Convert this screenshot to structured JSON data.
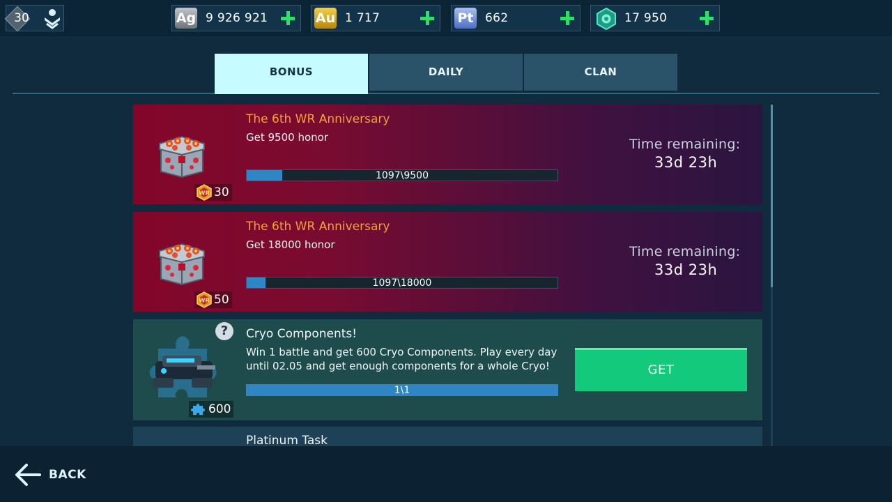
{
  "header": {
    "level": "30",
    "currencies": [
      {
        "symbol": "Ag",
        "value": "9 926 921",
        "color": "#9aa0a5"
      },
      {
        "symbol": "Au",
        "value": "1 717",
        "color": "#d4a017"
      },
      {
        "symbol": "Pt",
        "value": "662",
        "color": "#6b8bd8"
      },
      {
        "symbol": "",
        "icon": "key-hexagon-icon",
        "value": "17 950",
        "color": "#2fc4a0"
      }
    ],
    "add_icon": "plus-icon"
  },
  "tabs": [
    {
      "label": "BONUS",
      "active": true
    },
    {
      "label": "DAILY",
      "active": false
    },
    {
      "label": "CLAN",
      "active": false
    }
  ],
  "tasks": [
    {
      "title": "The 6th WR Anniversary",
      "description": "Get 9500 honor",
      "progress_text": "1097\\9500",
      "progress": 0.115,
      "time_label": "Time remaining:",
      "time_value": "33d 23h",
      "reward_icon": "wr-token-icon",
      "reward": "30",
      "image": "chest-icon"
    },
    {
      "title": "The 6th WR Anniversary",
      "description": "Get 18000 honor",
      "progress_text": "1097\\18000",
      "progress": 0.061,
      "time_label": "Time remaining:",
      "time_value": "33d 23h",
      "reward_icon": "wr-token-icon",
      "reward": "50",
      "image": "chest-icon"
    },
    {
      "title": "Cryo Components!",
      "description": "Win 1 battle and get 600 Cryo Components. Play every day until 02.05 and get enough components for a whole Cryo!",
      "progress_text": "1\\1",
      "progress": 1.0,
      "button_label": "GET",
      "help": "?",
      "reward_icon": "puzzle-piece-icon",
      "reward": "600",
      "image": "cryo-robot-icon"
    },
    {
      "title": "Platinum Task"
    }
  ],
  "footer": {
    "back_label": "BACK"
  },
  "colors": {
    "accent_green": "#2ee06a",
    "get_button": "#13c97c",
    "title_orange": "#f2a23a",
    "active_tab": "#c6fbff",
    "progress_fill": "#2e87c4"
  }
}
